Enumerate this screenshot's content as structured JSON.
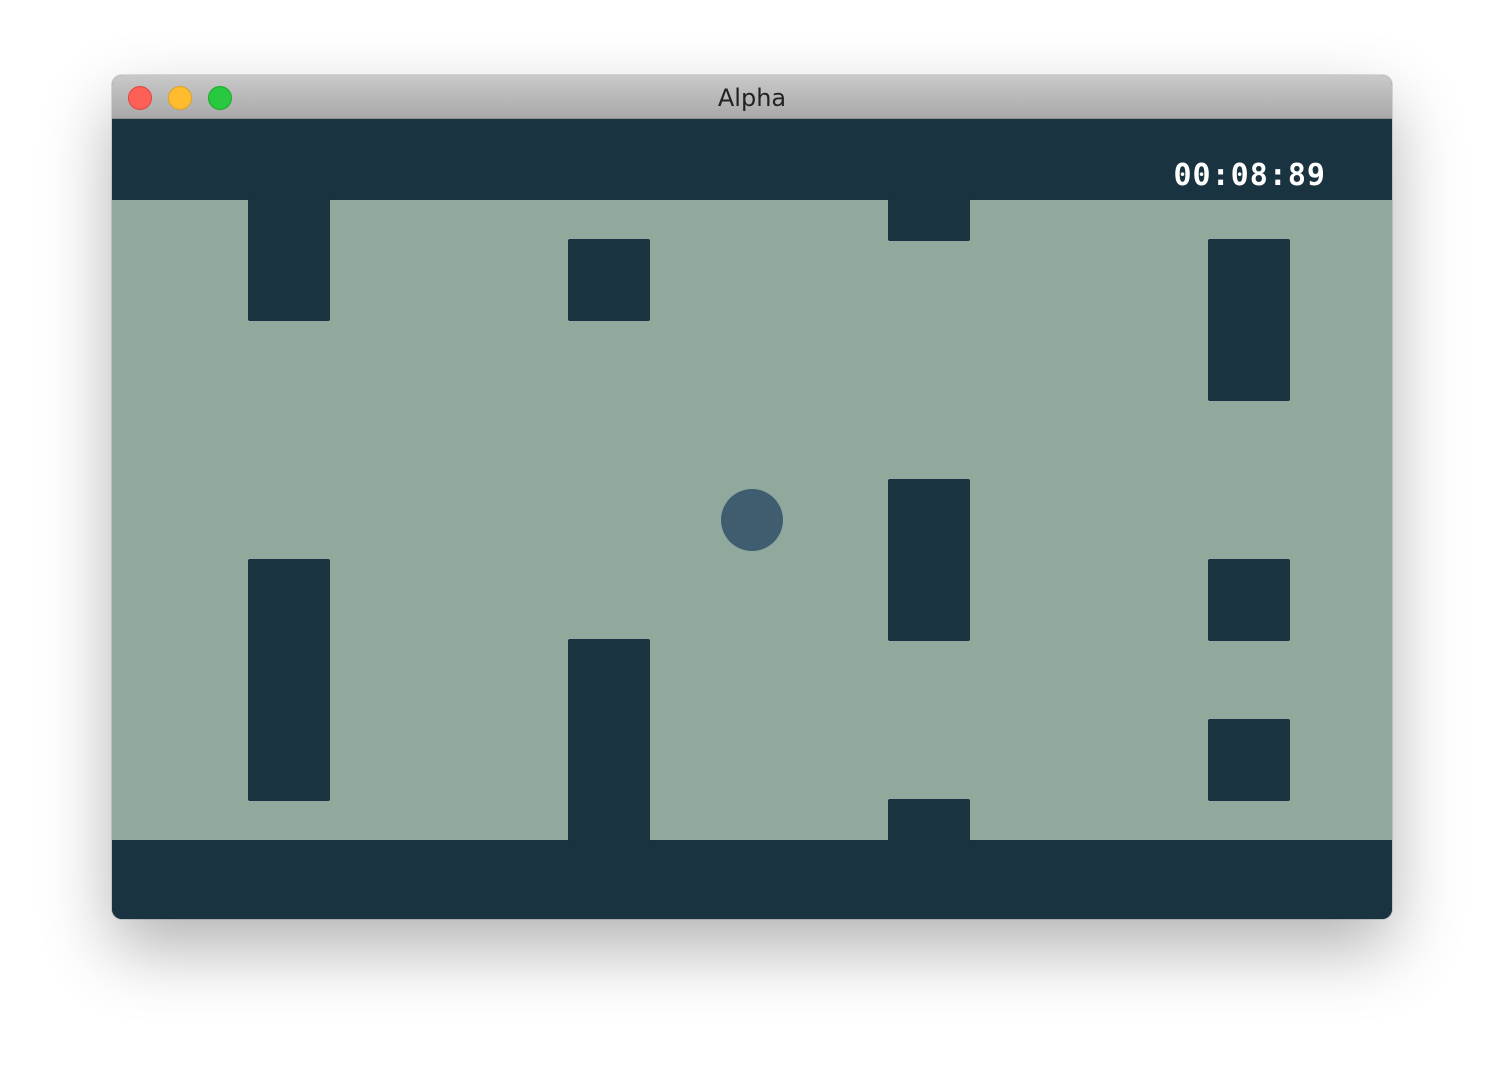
{
  "window": {
    "title": "Alpha"
  },
  "hud": {
    "timer": "00:08:89"
  },
  "colors": {
    "wall": "#193340",
    "field": "#91a99c",
    "ball": "#3f5d6e"
  }
}
